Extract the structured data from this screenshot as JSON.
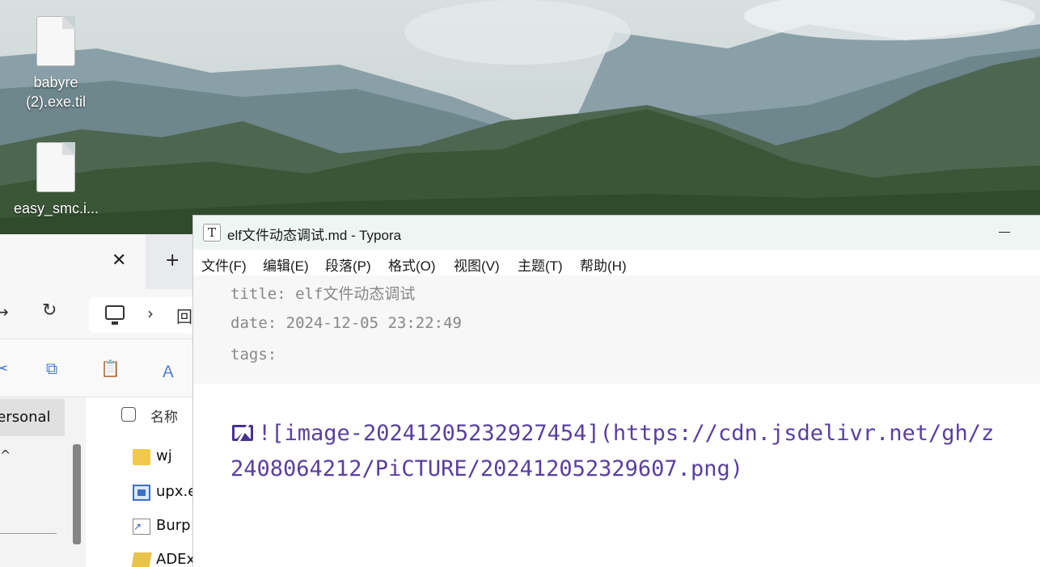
{
  "desktop": {
    "icons": [
      {
        "label_line1": "babyre",
        "label_line2": "(2).exe.til",
        "icon": "file-icon"
      },
      {
        "label_line1": "easy_smc.i...",
        "label_line2": "",
        "icon": "file-icon"
      }
    ]
  },
  "explorer": {
    "tab_close": "✕",
    "new_tab": "+",
    "refresh": "↻",
    "back": "→",
    "address_chevron": "›",
    "address_next": "回",
    "nav_selected": "Personal",
    "nav_expand": "^",
    "column_name": "名称",
    "rows": [
      {
        "name": "wj",
        "icon": "folder-icon"
      },
      {
        "name": "upx.exe",
        "icon": "exe-icon"
      },
      {
        "name": "Burp",
        "icon": "shortcut-icon"
      },
      {
        "name": "ADExplorer",
        "icon": "folder-icon"
      }
    ]
  },
  "typora": {
    "app_icon_letter": "T",
    "title": "elf文件动态调试.md - Typora",
    "menu": [
      "文件(F)",
      "编辑(E)",
      "段落(P)",
      "格式(O)",
      "视图(V)",
      "主题(T)",
      "帮助(H)"
    ],
    "front_matter": {
      "title_line": "title: elf文件动态调试",
      "date_line": "date: 2024-12-05 23:22:49",
      "tags_line": "tags:"
    },
    "content": {
      "line1": "![image-20241205232927454](https://cdn.jsdelivr.net/gh/z",
      "line2": "2408064212/PiCTURE/202412052329607.png)"
    }
  }
}
